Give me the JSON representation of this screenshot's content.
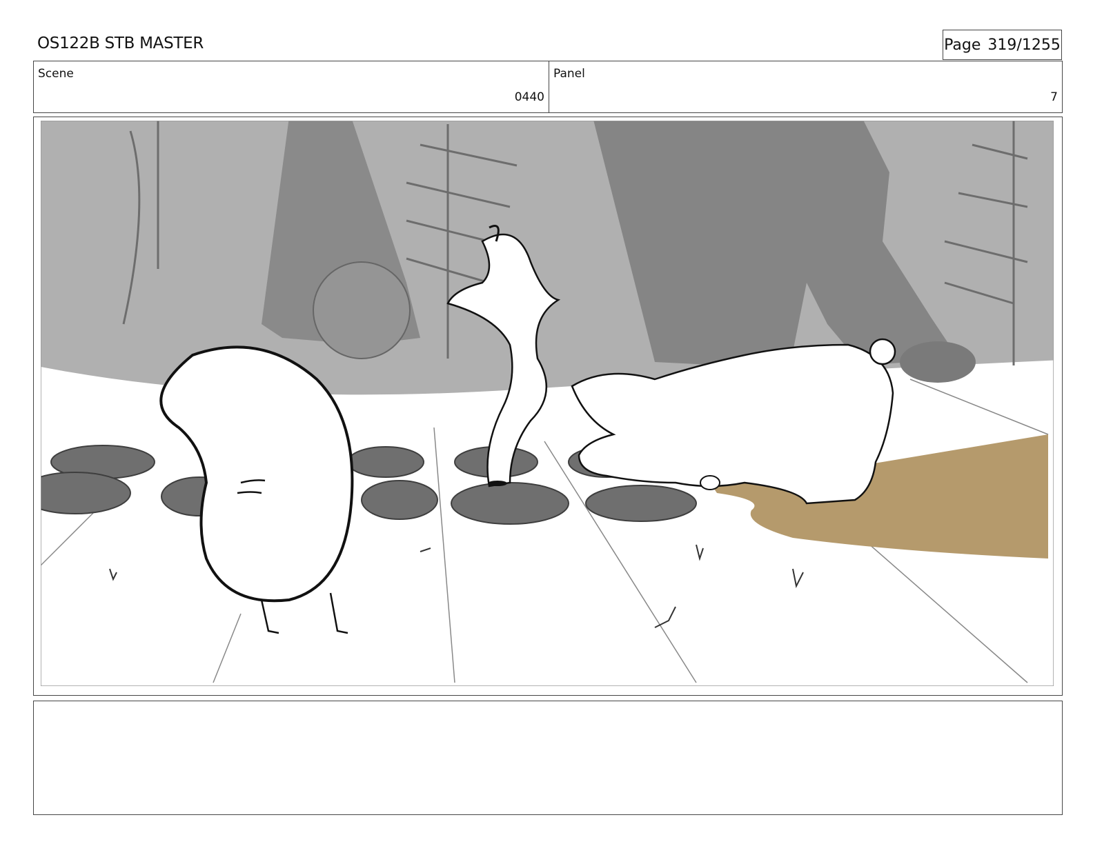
{
  "header": {
    "title": "OS122B STB MASTER",
    "page_label": "Page",
    "page_number": "319/1255"
  },
  "info": {
    "scene_label": "Scene",
    "scene_value": "0440",
    "panel_label": "Panel",
    "panel_value": "7"
  },
  "frame": {
    "background_color": "#b0b0b0",
    "ground_color": "#ffffff",
    "dirt_color": "#b59a6c"
  },
  "notes": {
    "text": ""
  }
}
